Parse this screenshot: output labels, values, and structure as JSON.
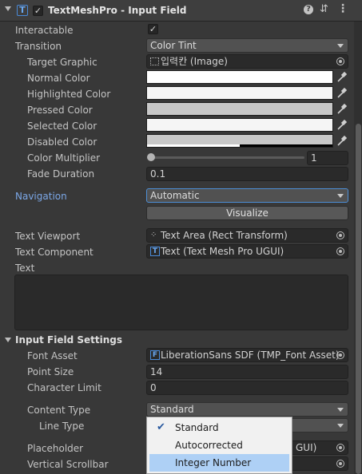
{
  "header": {
    "title": "TextMeshPro - Input Field",
    "enabled": true
  },
  "rows": {
    "interactable": {
      "label": "Interactable",
      "checked": true
    },
    "transition": {
      "label": "Transition",
      "value": "Color Tint"
    },
    "target_graphic": {
      "label": "Target Graphic",
      "value": "입력칸 (Image)"
    },
    "normal_color": {
      "label": "Normal Color",
      "color": "#ffffff"
    },
    "highlighted_color": {
      "label": "Highlighted Color",
      "color": "#f5f5f5"
    },
    "pressed_color": {
      "label": "Pressed Color",
      "color": "#c8c8c8"
    },
    "selected_color": {
      "label": "Selected Color",
      "color": "#f5f5f5"
    },
    "disabled_color": {
      "label": "Disabled Color",
      "color": "#c8c8c8"
    },
    "color_multiplier": {
      "label": "Color Multiplier",
      "value": "1",
      "slider_fraction": 0.0
    },
    "fade_duration": {
      "label": "Fade Duration",
      "value": "0.1"
    },
    "navigation": {
      "label": "Navigation",
      "value": "Automatic",
      "visualize_label": "Visualize"
    },
    "text_viewport": {
      "label": "Text Viewport",
      "value": "Text Area (Rect Transform)"
    },
    "text_component": {
      "label": "Text Component",
      "value": "Text (Text Mesh Pro UGUI)"
    },
    "text": {
      "label": "Text",
      "value": ""
    }
  },
  "settings": {
    "section_title": "Input Field Settings",
    "font_asset": {
      "label": "Font Asset",
      "value": "LiberationSans SDF (TMP_Font Asset)"
    },
    "point_size": {
      "label": "Point Size",
      "value": "14"
    },
    "character_limit": {
      "label": "Character Limit",
      "value": "0"
    },
    "content_type": {
      "label": "Content Type",
      "value": "Standard"
    },
    "line_type": {
      "label": "Line Type",
      "value": ""
    },
    "placeholder": {
      "label": "Placeholder",
      "value": "GUI)"
    },
    "vertical_scrollbar": {
      "label": "Vertical Scrollbar",
      "value": ""
    }
  },
  "content_type_menu": {
    "options": [
      "Standard",
      "Autocorrected",
      "Integer Number"
    ],
    "checked": "Standard",
    "highlighted": "Integer Number"
  },
  "colors": {
    "background": "#383838",
    "accent_blue": "#7ba7e6",
    "menu_highlight": "#aed0f5"
  }
}
